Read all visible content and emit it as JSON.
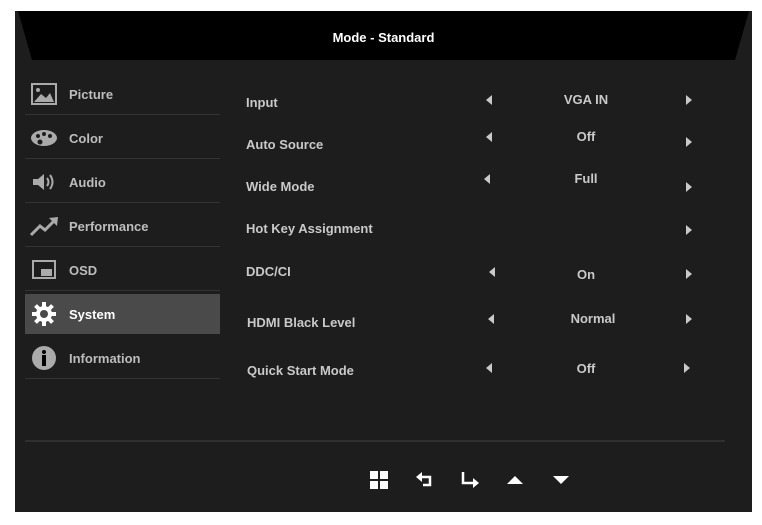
{
  "header": {
    "title": "Mode - Standard"
  },
  "sidebar": {
    "items": [
      {
        "label": "Picture",
        "icon": "picture-icon"
      },
      {
        "label": "Color",
        "icon": "palette-icon"
      },
      {
        "label": "Audio",
        "icon": "speaker-icon"
      },
      {
        "label": "Performance",
        "icon": "trend-up-icon"
      },
      {
        "label": "OSD",
        "icon": "osd-window-icon"
      },
      {
        "label": "System",
        "icon": "gear-icon",
        "active": true
      },
      {
        "label": "Information",
        "icon": "info-icon"
      }
    ]
  },
  "settings": [
    {
      "label": "Input",
      "value": "VGA IN"
    },
    {
      "label": "Auto Source",
      "value": "Off"
    },
    {
      "label": "Wide Mode",
      "value": "Full"
    },
    {
      "label": "Hot Key Assignment",
      "value": ""
    },
    {
      "label": "DDC/CI",
      "value": "On"
    },
    {
      "label": "HDMI Black Level",
      "value": "Normal"
    },
    {
      "label": "Quick Start Mode",
      "value": "Off"
    }
  ],
  "nav_icons": [
    "menu-grid-icon",
    "back-icon",
    "enter-icon",
    "up-icon",
    "down-icon"
  ]
}
